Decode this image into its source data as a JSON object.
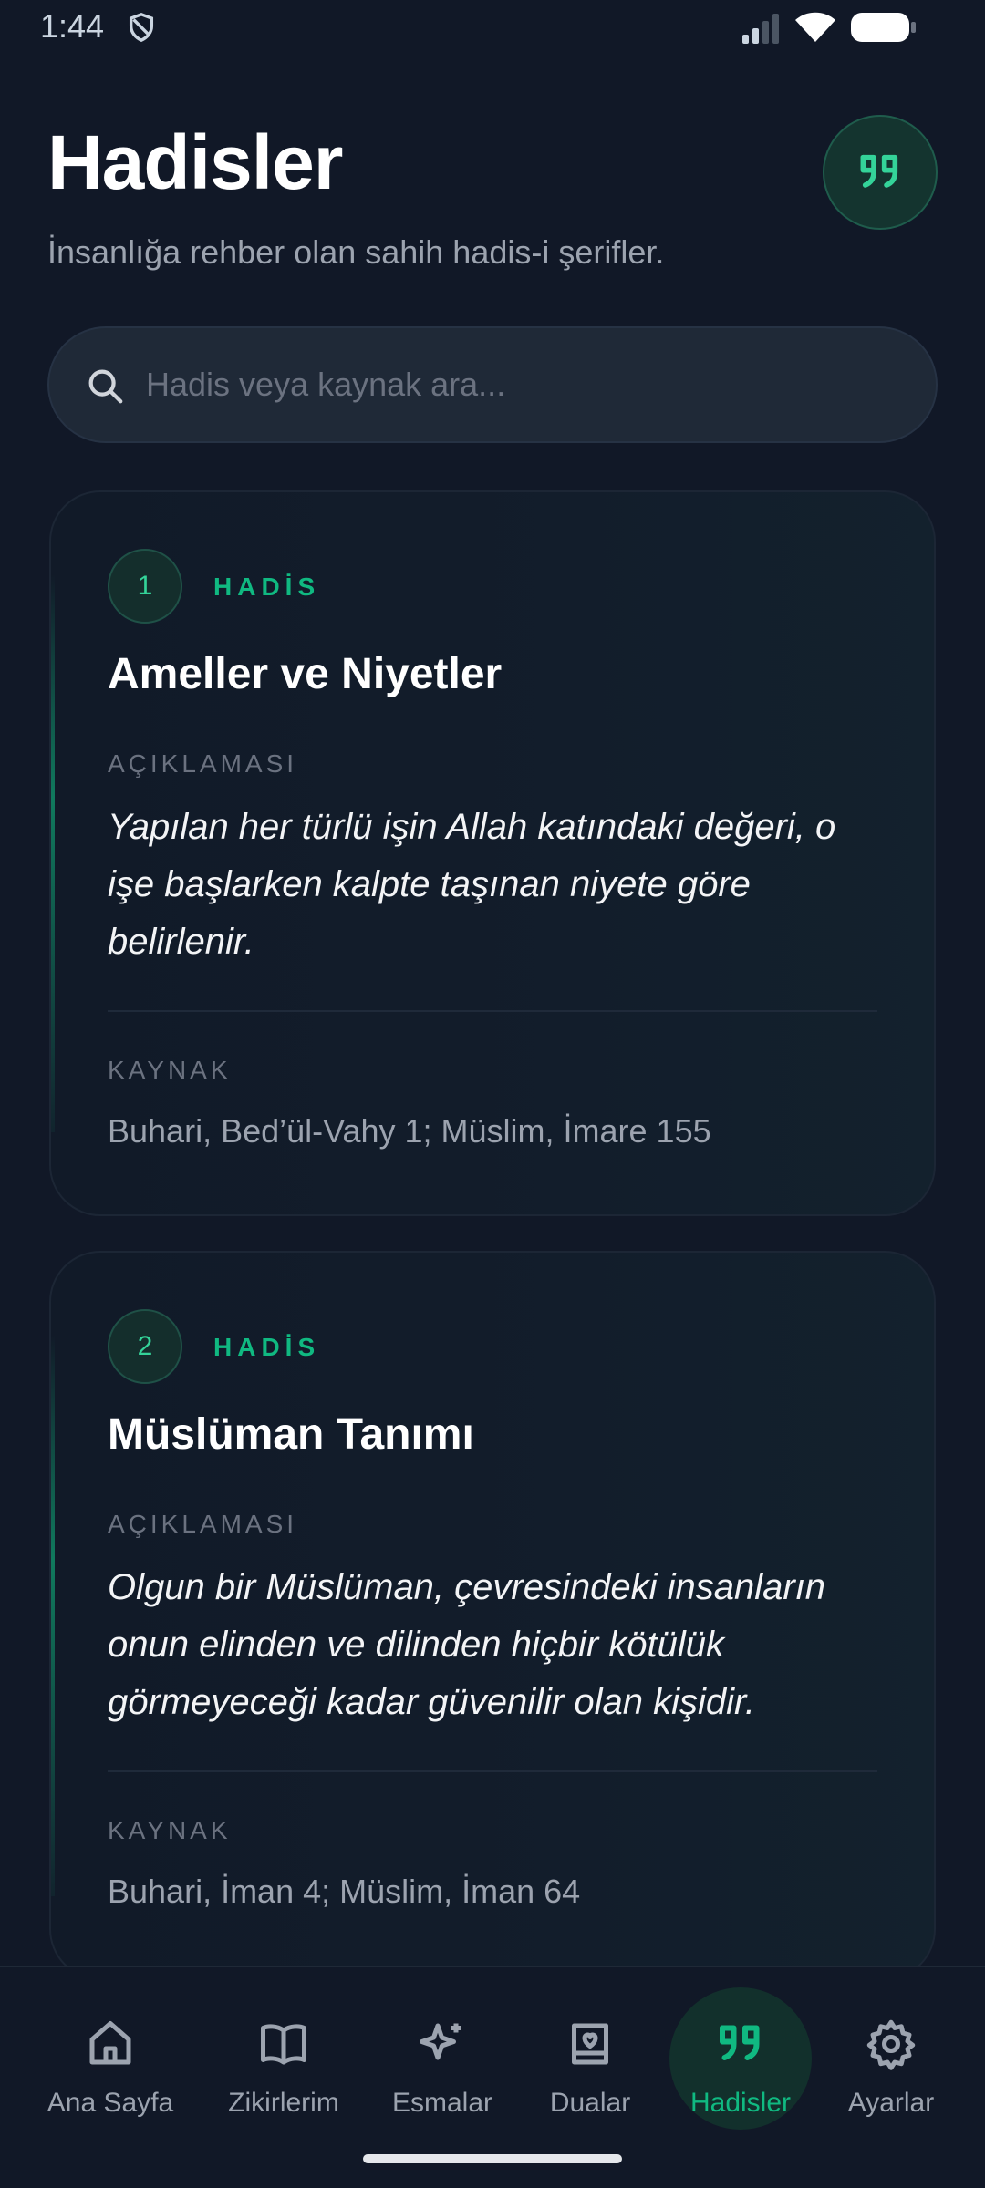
{
  "status_bar": {
    "time": "1:44"
  },
  "header": {
    "title": "Hadisler",
    "subtitle": "İnsanlığa rehber olan sahih hadis-i şerifler.",
    "badge_icon": "quote-icon"
  },
  "search": {
    "placeholder": "Hadis veya kaynak ara...",
    "value": ""
  },
  "hadisler": [
    {
      "number": "1",
      "label": "HADİS",
      "title": "Ameller ve Niyetler",
      "description_label": "AÇIKLAMASI",
      "description": "Yapılan her türlü işin Allah katındaki değeri, o işe başlarken kalpte taşınan niyete göre belirlenir.",
      "source_label": "KAYNAK",
      "source": "Buhari, Bed’ül-Vahy 1; Müslim, İmare 155"
    },
    {
      "number": "2",
      "label": "HADİS",
      "title": "Müslüman Tanımı",
      "description_label": "AÇIKLAMASI",
      "description": "Olgun bir Müslüman, çevresindeki insanların onun elinden ve dilinden hiçbir kötülük görmeyeceği kadar güvenilir olan kişidir.",
      "source_label": "KAYNAK",
      "source": "Buhari, İman 4; Müslim, İman 64"
    }
  ],
  "nav": {
    "active": "Hadisler",
    "items": [
      {
        "label": "Ana Sayfa",
        "icon": "home-icon"
      },
      {
        "label": "Zikirlerim",
        "icon": "book-icon"
      },
      {
        "label": "Esmalar",
        "icon": "sparkles-icon"
      },
      {
        "label": "Dualar",
        "icon": "prayer-book-icon"
      },
      {
        "label": "Hadisler",
        "icon": "quote-icon"
      },
      {
        "label": "Ayarlar",
        "icon": "gear-icon"
      }
    ]
  },
  "colors": {
    "background": "#111827",
    "accent": "#10b981",
    "card": "#121d2b",
    "muted_text": "#9ca3af"
  }
}
